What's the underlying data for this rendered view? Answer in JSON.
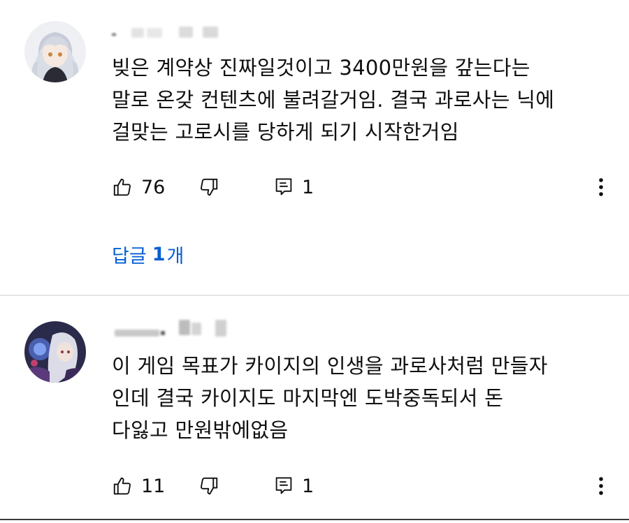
{
  "comments": [
    {
      "author": "",
      "lines": [
        "빚은 계약상 진짜일것이고 3400만원을 갚는다는",
        "말로 온갖 컨텐츠에 불려갈거임. 결국 과로사는 닉에",
        "걸맞는 고로시를 당하게 되기 시작한거임"
      ],
      "likes": "76",
      "reply_count": "1",
      "replies_label": {
        "prefix": "답글",
        "count": "1",
        "suffix": "개"
      },
      "icons": {
        "like": "thumb-up-icon",
        "dislike": "thumb-down-icon",
        "reply": "comment-reply-icon",
        "more": "more-vertical-icon"
      }
    },
    {
      "author": "",
      "lines": [
        "이 게임 목표가 카이지의 인생을 과로사처럼 만들자",
        "인데 결국 카이지도 마지막엔 도박중독되서 돈",
        "다잃고 만원밖에없음"
      ],
      "likes": "11",
      "reply_count": "1",
      "icons": {
        "like": "thumb-up-icon",
        "dislike": "thumb-down-icon",
        "reply": "comment-reply-icon",
        "more": "more-vertical-icon"
      }
    }
  ],
  "colors": {
    "link": "#065fd4",
    "text": "#0f0f0f",
    "divider": "#e5e5e5"
  }
}
